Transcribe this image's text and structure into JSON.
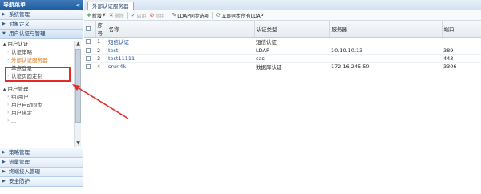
{
  "sidebar": {
    "title": "导航菜单",
    "collapse_icon": "double-chevron-left-icon",
    "sections_top": [
      {
        "label": "系统管理"
      },
      {
        "label": "对象定义"
      }
    ],
    "open_section": {
      "label": "用户认证与管理"
    },
    "tree": [
      {
        "type": "group",
        "label": "用户认证"
      },
      {
        "type": "item",
        "label": "认证策略"
      },
      {
        "type": "item",
        "label": "外部认证服务器",
        "active": true
      },
      {
        "type": "item",
        "label": "单点登录"
      },
      {
        "type": "item",
        "label": "认证页面定制"
      },
      {
        "type": "gap"
      },
      {
        "type": "group",
        "label": "用户管理"
      },
      {
        "type": "item",
        "label": "组/用户"
      },
      {
        "type": "item",
        "label": "用户自动同步"
      },
      {
        "type": "item",
        "label": "用户绑定"
      },
      {
        "type": "item",
        "label": "..."
      }
    ],
    "sections_bottom": [
      {
        "label": "策略管理"
      },
      {
        "label": "流量管理"
      },
      {
        "label": "终端接入管理"
      },
      {
        "label": "安全防护"
      }
    ]
  },
  "tab": {
    "label": "外部认证服务器"
  },
  "toolbar": {
    "add": "新增",
    "delete": "删除",
    "enable": "启用",
    "disable": "禁用",
    "ldap_sync": "LDAP同步选项",
    "sync_now": "立即同步所有LDAP"
  },
  "grid": {
    "columns": [
      "序号",
      "名称",
      "认证类型",
      "服务器",
      "端口"
    ],
    "rows": [
      {
        "index": "1",
        "name": "短信认证",
        "type": "短信认证",
        "server": "-",
        "port": "-"
      },
      {
        "index": "2",
        "name": "test",
        "type": "LDAP",
        "server": "10.10.10.13",
        "port": "389"
      },
      {
        "index": "3",
        "name": "test11111",
        "type": "cas",
        "server": "-",
        "port": "443"
      },
      {
        "index": "4",
        "name": "srun4k",
        "type": "数据库认证",
        "server": "172.16.245.50",
        "port": "3306"
      }
    ]
  },
  "annotation": {
    "color": "#e32b2b"
  }
}
